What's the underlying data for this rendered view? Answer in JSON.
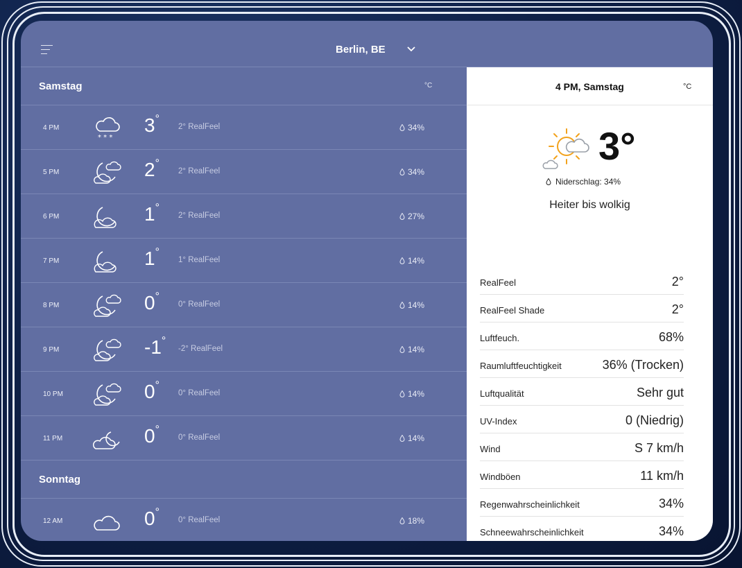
{
  "location": "Berlin, BE",
  "forecast": {
    "unit": "°C",
    "days": [
      {
        "label": "Samstag",
        "hours": [
          {
            "time": "4 PM",
            "icon": "snow-cloud-icon",
            "temp": "3",
            "realfeel": "2° RealFeel",
            "precip": "34%"
          },
          {
            "time": "5 PM",
            "icon": "moon-cloud-icon",
            "temp": "2",
            "realfeel": "2° RealFeel",
            "precip": "34%"
          },
          {
            "time": "6 PM",
            "icon": "moon-icon",
            "temp": "1",
            "realfeel": "2° RealFeel",
            "precip": "27%"
          },
          {
            "time": "7 PM",
            "icon": "moon-icon",
            "temp": "1",
            "realfeel": "1° RealFeel",
            "precip": "14%"
          },
          {
            "time": "8 PM",
            "icon": "moon-cloud-icon",
            "temp": "0",
            "realfeel": "0° RealFeel",
            "precip": "14%"
          },
          {
            "time": "9 PM",
            "icon": "moon-cloud-icon",
            "temp": "-1",
            "realfeel": "-2° RealFeel",
            "precip": "14%"
          },
          {
            "time": "10 PM",
            "icon": "moon-cloud-icon",
            "temp": "0",
            "realfeel": "0° RealFeel",
            "precip": "14%"
          },
          {
            "time": "11 PM",
            "icon": "cloud-moon-icon",
            "temp": "0",
            "realfeel": "0° RealFeel",
            "precip": "14%"
          }
        ]
      },
      {
        "label": "Sonntag",
        "hours": [
          {
            "time": "12 AM",
            "icon": "cloud-icon",
            "temp": "0",
            "realfeel": "0° RealFeel",
            "precip": "18%"
          }
        ]
      }
    ]
  },
  "detail": {
    "title": "4 PM, Samstag",
    "unit": "°C",
    "icon": "sun-cloud-icon",
    "temp": "3°",
    "precip": "Niderschlag: 34%",
    "description": "Heiter bis wolkig",
    "rows": [
      {
        "label": "RealFeel",
        "value": "2°"
      },
      {
        "label": "RealFeel Shade",
        "value": "2°"
      },
      {
        "label": "Luftfeuch.",
        "value": "68%"
      },
      {
        "label": "Raumluftfeuchtigkeit",
        "value": "36% (Trocken)"
      },
      {
        "label": "Luftqualität",
        "value": "Sehr gut"
      },
      {
        "label": "UV-Index",
        "value": "0 (Niedrig)"
      },
      {
        "label": "Wind",
        "value": "S 7 km/h"
      },
      {
        "label": "Windböen",
        "value": "11 km/h"
      },
      {
        "label": "Regenwahrscheinlichkeit",
        "value": "34%"
      },
      {
        "label": "Schneewahrscheinlichkeit",
        "value": "34%"
      }
    ]
  }
}
